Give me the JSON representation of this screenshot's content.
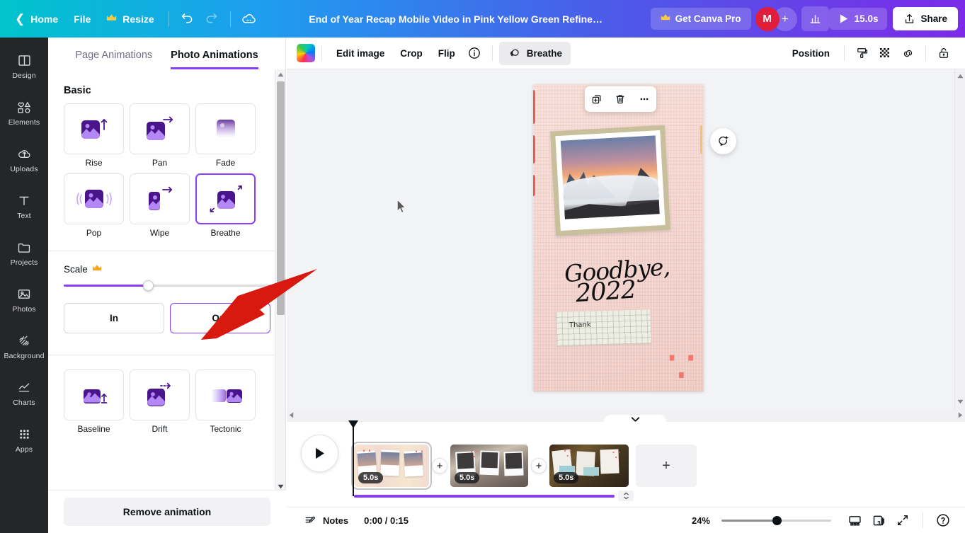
{
  "topbar": {
    "back_icon": "chevron-left-icon",
    "home_label": "Home",
    "file_label": "File",
    "resize_label": "Resize",
    "resize_crown": "crown-icon",
    "undo_icon": "undo-icon",
    "redo_icon": "redo-icon",
    "cloud_icon": "cloud-saved-icon",
    "doc_title": "End of Year Recap Mobile Video in Pink Yellow Green Refine…",
    "pro_label": "Get Canva Pro",
    "avatar_initial": "M",
    "add_collaborator": "+",
    "insights_icon": "bar-chart-icon",
    "duration_label": "15.0s",
    "play_icon": "play-icon",
    "share_label": "Share",
    "share_icon": "share-upload-icon"
  },
  "rail": {
    "items": [
      {
        "label": "Design",
        "icon": "design-grid-icon"
      },
      {
        "label": "Elements",
        "icon": "elements-shapes-icon"
      },
      {
        "label": "Uploads",
        "icon": "upload-cloud-icon"
      },
      {
        "label": "Text",
        "icon": "text-t-icon"
      },
      {
        "label": "Projects",
        "icon": "folder-icon"
      },
      {
        "label": "Photos",
        "icon": "photo-icon"
      },
      {
        "label": "Background",
        "icon": "background-hatch-icon"
      },
      {
        "label": "Charts",
        "icon": "chart-line-icon"
      },
      {
        "label": "Apps",
        "icon": "apps-grid-icon"
      }
    ]
  },
  "panel": {
    "tabs": [
      {
        "label": "Page Animations",
        "active": false
      },
      {
        "label": "Photo Animations",
        "active": true
      }
    ],
    "section_title": "Basic",
    "animations": [
      {
        "label": "Rise",
        "icon": "rise-anim-icon",
        "selected": false
      },
      {
        "label": "Pan",
        "icon": "pan-anim-icon",
        "selected": false
      },
      {
        "label": "Fade",
        "icon": "fade-anim-icon",
        "selected": false
      },
      {
        "label": "Pop",
        "icon": "pop-anim-icon",
        "selected": false
      },
      {
        "label": "Wipe",
        "icon": "wipe-anim-icon",
        "selected": false
      },
      {
        "label": "Breathe",
        "icon": "breathe-anim-icon",
        "selected": true
      }
    ],
    "animations_row2": [
      {
        "label": "Baseline",
        "icon": "baseline-anim-icon",
        "selected": false
      },
      {
        "label": "Drift",
        "icon": "drift-anim-icon",
        "selected": false
      },
      {
        "label": "Tectonic",
        "icon": "tectonic-anim-icon",
        "selected": false
      }
    ],
    "scale_label": "Scale",
    "scale_crown": "crown-icon",
    "scale_percent": 41,
    "direction_in": "In",
    "direction_out": "Out",
    "direction_selected": "Out",
    "remove_label": "Remove animation",
    "scroll_up_icon": "scroll-up-arrow-icon",
    "scroll_down_icon": "scroll-down-arrow-icon"
  },
  "canvas_toolbar": {
    "color_swatch": "image-color-swatch",
    "edit_image": "Edit image",
    "crop": "Crop",
    "flip": "Flip",
    "info_icon": "info-circle-icon",
    "animate_icon": "animate-overlap-icon",
    "animate_label": "Breathe",
    "position": "Position",
    "transparency_icon": "transparency-checker-icon",
    "paint_icon": "paint-roller-icon",
    "link_icon": "link-chain-icon",
    "lock_icon": "lock-open-icon"
  },
  "canvas": {
    "design_text_headline": "Goodbye,",
    "design_text_year": "2022",
    "note_text": "Thank",
    "float_toolbar": {
      "duplicate_icon": "duplicate-icon",
      "delete_icon": "trash-icon",
      "more_icon": "more-dots-icon"
    },
    "comment_icon": "add-comment-icon",
    "cursor_icon": "mouse-pointer-icon"
  },
  "timeline": {
    "collapse_icon": "chevron-down-icon",
    "play_icon": "play-triangle-icon",
    "clips": [
      {
        "duration": "5.0s",
        "selected": true
      },
      {
        "duration": "5.0s",
        "selected": false
      },
      {
        "duration": "5.0s",
        "selected": false
      }
    ],
    "transition_plus": "+",
    "add_page_plus": "+",
    "resize_handle_icon": "resize-handle-icon"
  },
  "footer": {
    "notes_icon": "notes-icon",
    "notes_label": "Notes",
    "time_display": "0:00 / 0:15",
    "zoom_value": "24%",
    "zoom_percent": 24,
    "present_icon": "present-screen-icon",
    "pages_icon": "grid-pages-icon",
    "page_count": "3",
    "fullscreen_icon": "fullscreen-expand-icon",
    "help_icon": "help-question-icon"
  },
  "annotation": {
    "arrow": "red-pointer-arrow"
  },
  "colors": {
    "brand_purple": "#8b3dff",
    "accent_red": "#d8190f",
    "avatar_red": "#e01e3c",
    "crown_gold": "#ffc83d"
  }
}
